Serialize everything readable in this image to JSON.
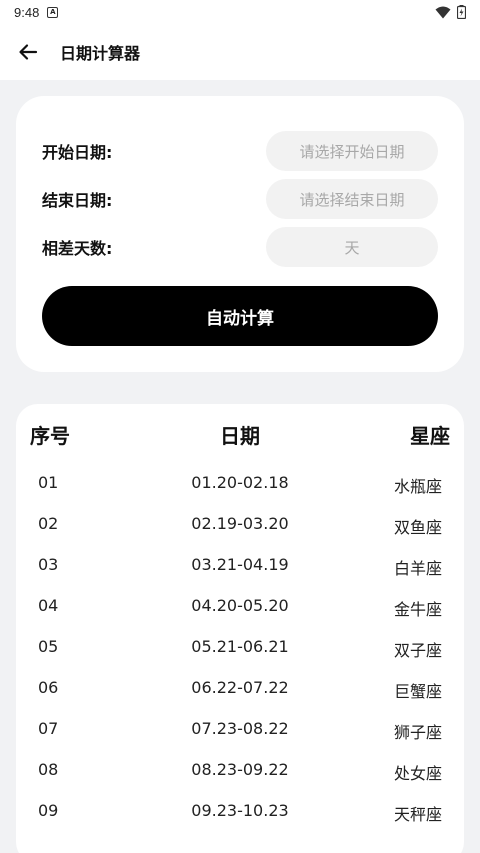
{
  "status": {
    "time": "9:48",
    "notif_glyph": "A"
  },
  "app_bar": {
    "title": "日期计算器"
  },
  "form": {
    "start_label": "开始日期:",
    "start_placeholder": "请选择开始日期",
    "end_label": "结束日期:",
    "end_placeholder": "请选择结束日期",
    "diff_label": "相差天数:",
    "diff_unit": "天",
    "calc_button": "自动计算"
  },
  "table": {
    "headers": {
      "num": "序号",
      "date": "日期",
      "sign": "星座"
    },
    "rows": [
      {
        "num": "01",
        "date": "01.20-02.18",
        "sign": "水瓶座"
      },
      {
        "num": "02",
        "date": "02.19-03.20",
        "sign": "双鱼座"
      },
      {
        "num": "03",
        "date": "03.21-04.19",
        "sign": "白羊座"
      },
      {
        "num": "04",
        "date": "04.20-05.20",
        "sign": "金牛座"
      },
      {
        "num": "05",
        "date": "05.21-06.21",
        "sign": "双子座"
      },
      {
        "num": "06",
        "date": "06.22-07.22",
        "sign": "巨蟹座"
      },
      {
        "num": "07",
        "date": "07.23-08.22",
        "sign": "狮子座"
      },
      {
        "num": "08",
        "date": "08.23-09.22",
        "sign": "处女座"
      },
      {
        "num": "09",
        "date": "09.23-10.23",
        "sign": "天秤座"
      }
    ]
  }
}
